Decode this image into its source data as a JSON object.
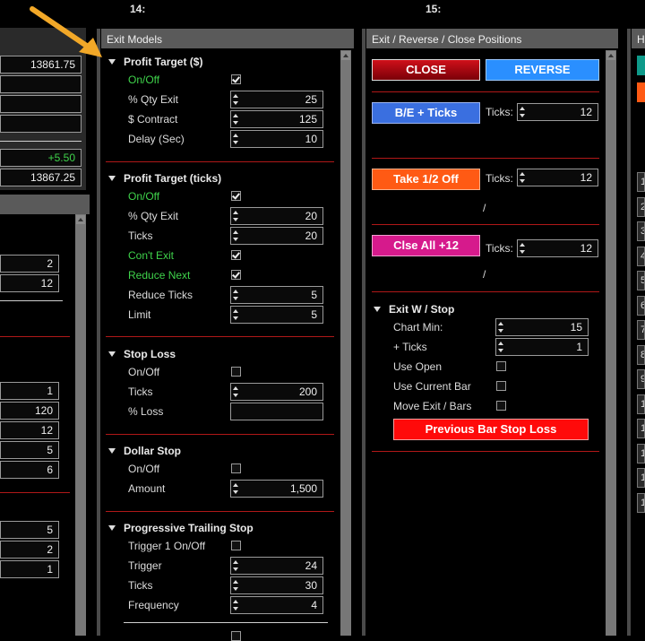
{
  "top": {
    "col14": "14:",
    "col15": "15:"
  },
  "left_panel": {
    "upper_values": [
      "13861.75",
      "",
      "",
      ""
    ],
    "change_value": "+5.50",
    "last_value": "13867.25",
    "mid_values": [
      "2",
      "12"
    ],
    "lower_values": [
      "1",
      "120",
      "12",
      "5",
      "6"
    ],
    "bottom_values": [
      "5",
      "2",
      "1"
    ]
  },
  "exit_models": {
    "header": "Exit Models",
    "profit_target_dollar": {
      "title": "Profit Target ($)",
      "onoff_label": "On/Off",
      "qty_label": "% Qty Exit",
      "qty_value": "25",
      "contract_label": "$ Contract",
      "contract_value": "125",
      "delay_label": "Delay (Sec)",
      "delay_value": "10"
    },
    "profit_target_ticks": {
      "title": "Profit Target (ticks)",
      "onoff_label": "On/Off",
      "qty_label": "% Qty Exit",
      "qty_value": "20",
      "ticks_label": "Ticks",
      "ticks_value": "20",
      "cont_label": "Con't Exit",
      "reduce_next_label": "Reduce Next",
      "reduce_ticks_label": "Reduce Ticks",
      "reduce_ticks_value": "5",
      "limit_label": "Limit",
      "limit_value": "5"
    },
    "stop_loss": {
      "title": "Stop Loss",
      "onoff_label": "On/Off",
      "ticks_label": "Ticks",
      "ticks_value": "200",
      "loss_label": "% Loss",
      "loss_value": ""
    },
    "dollar_stop": {
      "title": "Dollar Stop",
      "onoff_label": "On/Off",
      "amount_label": "Amount",
      "amount_value": "1,500"
    },
    "progressive": {
      "title": "Progressive Trailing Stop",
      "trigger_onoff_label": "Trigger 1 On/Off",
      "trigger_label": "Trigger",
      "trigger_value": "24",
      "ticks_label": "Ticks",
      "ticks_value": "30",
      "frequency_label": "Frequency",
      "frequency_value": "4"
    }
  },
  "exit_positions": {
    "header": "Exit / Reverse / Close Positions",
    "close_label": "CLOSE",
    "reverse_label": "REVERSE",
    "be_label": "B/E + Ticks",
    "ticks_label": "Ticks:",
    "be_ticks": "12",
    "take_half_label": "Take 1/2 Off",
    "take_half_ticks": "12",
    "slash": "/",
    "close_all_label": "Clse All +12",
    "close_all_ticks": "12",
    "exit_w_stop": {
      "title": "Exit W / Stop",
      "chart_min_label": "Chart Min:",
      "chart_min_value": "15",
      "plus_ticks_label": "+ Ticks",
      "plus_ticks_value": "1",
      "use_open_label": "Use Open",
      "use_current_label": "Use Current Bar",
      "move_exit_label": "Move Exit / Bars",
      "prev_bar_label": "Previous Bar Stop Loss"
    }
  },
  "right_panel": {
    "header": "H",
    "row_numbers": [
      "1",
      "2",
      "3",
      "4",
      "5",
      "6",
      "7",
      "8",
      "9",
      "1",
      "1",
      "1",
      "1",
      "1"
    ]
  },
  "colors": {
    "close": "#c0000a",
    "reverse": "#2a8fff",
    "be": "#3a6fe0",
    "take_half": "#ff5a14",
    "close_all": "#d61a8c",
    "prev_bar": "#ff0a0a",
    "green_label": "#3fd34b",
    "divider_red": "#b01818"
  }
}
